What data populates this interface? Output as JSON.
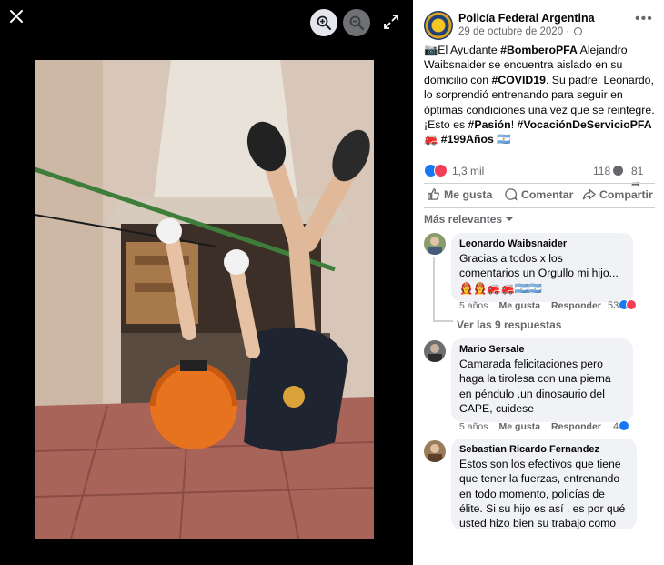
{
  "viewer": {
    "close_icon": "close-icon",
    "zoom_in_icon": "zoom-in-icon",
    "zoom_out_icon": "zoom-out-icon",
    "fullscreen_icon": "fullscreen-icon"
  },
  "post": {
    "page_name": "Policía Federal Argentina",
    "date": "29 de octubre de 2020 ·",
    "text_parts": {
      "p1": "📷El Ayudante ",
      "h1": "#BomberoPFA",
      "p2": " Alejandro Waibsnaider se encuentra aislado en su domicilio con ",
      "h2": "#COVID19",
      "p3": ". Su padre, Leonardo, lo sorprendió entrenando para seguir en óptimas condiciones una vez que se reintegre. ¡Esto es ",
      "h3": "#Pasión",
      "p4": "! ",
      "h4": "#VocaciónDeServicioPFA",
      "p5": " 🚒 ",
      "h5": "#199Años",
      "p6": " 🇦🇷"
    },
    "reactions": "1,3 mil",
    "comments_count": "118",
    "shares_count": "81",
    "actions": {
      "like": "Me gusta",
      "comment": "Comentar",
      "share": "Compartir"
    },
    "sort_label": "Más relevantes"
  },
  "comments": [
    {
      "name": "Leonardo Waibsnaider",
      "text": "Gracias a todos x los comentarios un Orgullo mi hijo... 👩‍🚒👩‍🚒🚒🚒🇦🇷🇦🇷",
      "age": "5 años",
      "like": "Me gusta",
      "reply": "Responder",
      "reactions": "53"
    },
    {
      "name": "Mario Sersale",
      "text": "Camarada felicitaciones pero haga la tirolesa con una pierna en péndulo .un dinosaurio del CAPE, cuidese",
      "age": "5 años",
      "like": "Me gusta",
      "reply": "Responder",
      "reactions": "4"
    },
    {
      "name": "Sebastian Ricardo Fernandez",
      "text": "Estos son los efectivos que tiene que tener la fuerzas, entrenando en todo momento, policías de élite. Si su hijo es así , es por qué usted hizo bien su trabajo como"
    }
  ],
  "replies_link": "Ver las 9 respuestas",
  "colors": {
    "like_blue": "#1877f2",
    "love_red": "#f33e58",
    "meta_gray": "#65676b",
    "bubble_gray": "#f0f2f5"
  }
}
